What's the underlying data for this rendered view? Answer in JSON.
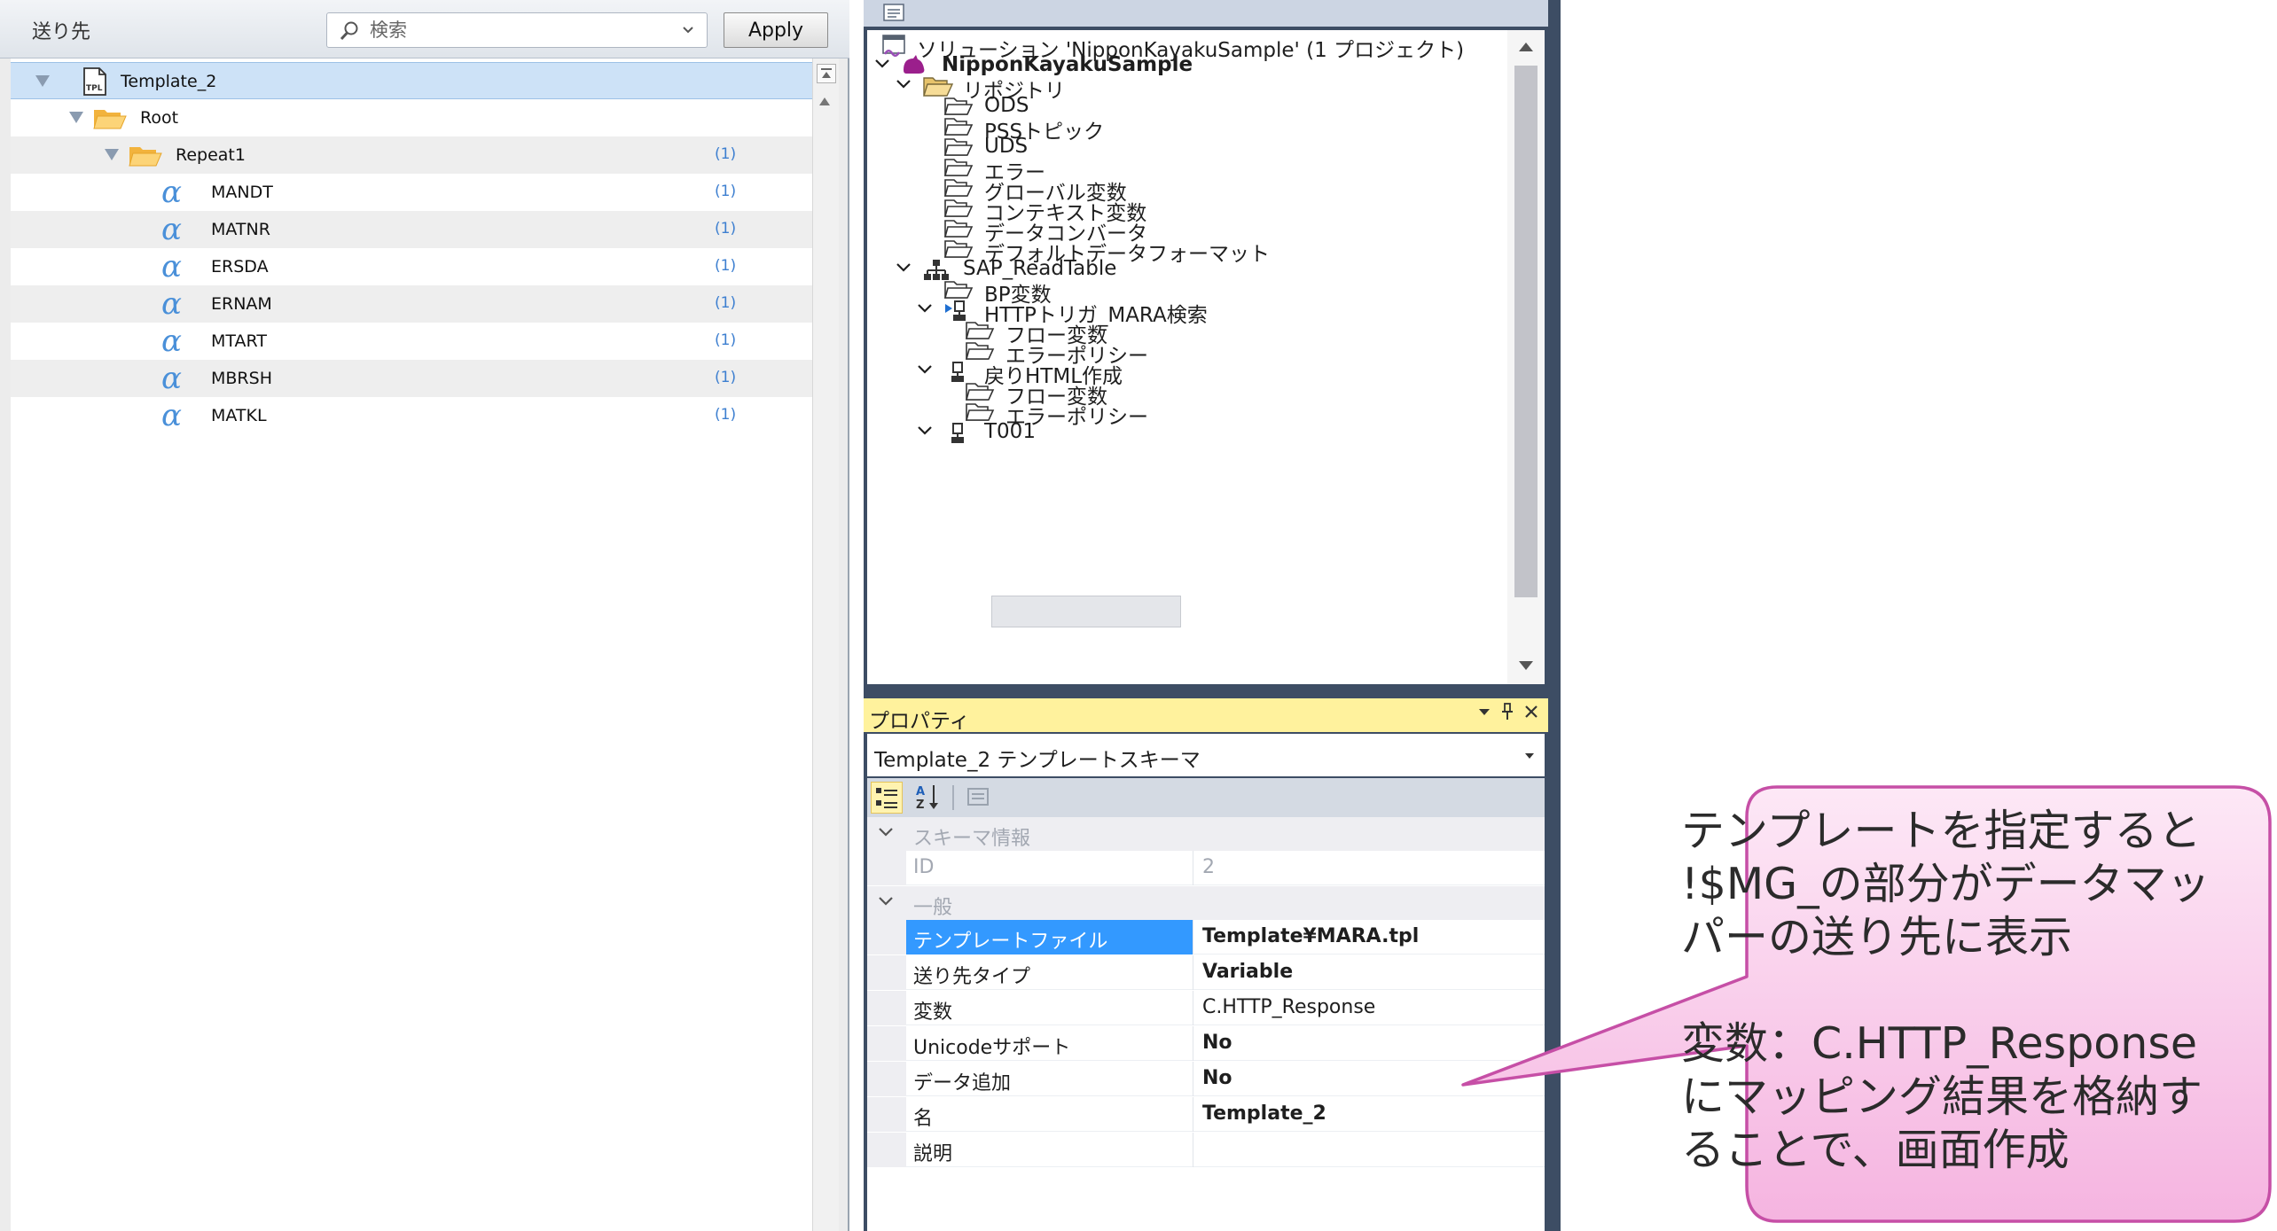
{
  "destination_panel": {
    "title": "送り先",
    "search": {
      "placeholder": "検索",
      "value": ""
    },
    "apply_label": "Apply",
    "tree": [
      {
        "label": "Template_2",
        "count": ""
      },
      {
        "label": "Root",
        "count": ""
      },
      {
        "label": "Repeat1",
        "count": "(1)"
      },
      {
        "label": "MANDT",
        "count": "(1)"
      },
      {
        "label": "MATNR",
        "count": "(1)"
      },
      {
        "label": "ERSDA",
        "count": "(1)"
      },
      {
        "label": "ERNAM",
        "count": "(1)"
      },
      {
        "label": "MTART",
        "count": "(1)"
      },
      {
        "label": "MBRSH",
        "count": "(1)"
      },
      {
        "label": "MATKL",
        "count": "(1)"
      }
    ]
  },
  "solution_explorer": {
    "items": [
      {
        "label": "ソリューション 'NipponKayakuSample' (1 プロジェクト)"
      },
      {
        "label": "NipponKayakuSample"
      },
      {
        "label": "リポジトリ"
      },
      {
        "label": "ODS"
      },
      {
        "label": "PSSトピック"
      },
      {
        "label": "UDS"
      },
      {
        "label": "エラー"
      },
      {
        "label": "グローバル変数"
      },
      {
        "label": "コンテキスト変数"
      },
      {
        "label": "データコンバータ"
      },
      {
        "label": "デフォルトデータフォーマット"
      },
      {
        "label": "SAP_ReadTable"
      },
      {
        "label": "BP変数"
      },
      {
        "label": "HTTPトリガ_MARA検索"
      },
      {
        "label": "フロー変数"
      },
      {
        "label": "エラーポリシー"
      },
      {
        "label": "戻りHTML作成"
      },
      {
        "label": "フロー変数"
      },
      {
        "label": "エラーポリシー"
      },
      {
        "label": "T001"
      }
    ]
  },
  "properties_panel": {
    "title": "プロパティ",
    "selector": "Template_2  テンプレートスキーマ",
    "categories": [
      {
        "label": "スキーマ情報"
      },
      {
        "label": "一般"
      }
    ],
    "rows": [
      {
        "name": "ID",
        "value": "2"
      },
      {
        "name": "テンプレートファイル",
        "value": "Template¥MARA.tpl"
      },
      {
        "name": "送り先タイプ",
        "value": "Variable"
      },
      {
        "name": "変数",
        "value": "C.HTTP_Response"
      },
      {
        "name": "Unicodeサポート",
        "value": "No"
      },
      {
        "name": "データ追加",
        "value": "No"
      },
      {
        "name": "名",
        "value": "Template_2"
      },
      {
        "name": "説明",
        "value": ""
      }
    ]
  },
  "callout": {
    "line1": "テンプレートを指定すると",
    "line2": "!$MG_の部分がデータマッ",
    "line3": "パーの送り先に表示",
    "line4": "変数：C.HTTP_Response",
    "line5": "にマッピング結果を格納す",
    "line6": "ることで、画面作成"
  },
  "colors": {
    "selection_blue": "#3399ff",
    "properties_title_yellow": "#fff29d",
    "callout_pink": "#f9c8ea",
    "callout_border": "#c64fa6"
  }
}
